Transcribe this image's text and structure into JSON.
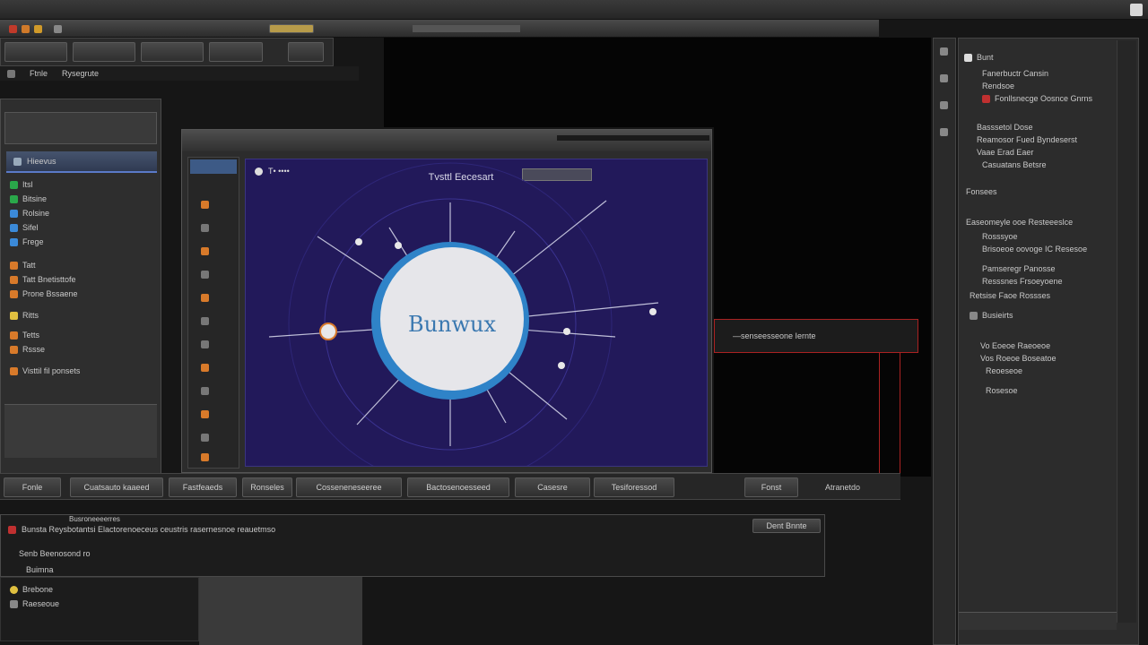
{
  "app": {
    "top_right_label": "▪"
  },
  "toolbar": {
    "menu_items": [
      "Ftnle",
      "Rysegrute"
    ]
  },
  "left_panel": {
    "header": "Hieevus",
    "items": [
      {
        "label": "Itsl",
        "color": "#2aa84a"
      },
      {
        "label": "Bitsine",
        "color": "#2aa84a"
      },
      {
        "label": "Rolsine",
        "color": "#3b8ad8"
      },
      {
        "label": "Sifel",
        "color": "#3b8ad8"
      },
      {
        "label": "Frege",
        "color": "#3b8ad8"
      },
      {
        "label": "Tatt",
        "color": "#d87a2a"
      },
      {
        "label": "Tatt Bnetisttofe",
        "color": "#d87a2a"
      },
      {
        "label": "Prone Bssaene",
        "color": "#d87a2a"
      },
      {
        "label": "Ritts",
        "color": "#e0c040"
      },
      {
        "label": "Tetts",
        "color": "#d87a2a"
      },
      {
        "label": "Rssse",
        "color": "#d87a2a"
      },
      {
        "label": "Visttil fil ponsets",
        "color": "#d87a2a"
      }
    ]
  },
  "canvas": {
    "header_label": "T• ••••",
    "title": "Tvsttl Eecesart",
    "node_label": "Bunwux",
    "accent": "#2f83c8",
    "background": "#22195a"
  },
  "tool_strip": {
    "icons": [
      "orange",
      "gray",
      "orange",
      "gray",
      "orange",
      "gray",
      "gray",
      "orange",
      "gray",
      "orange",
      "gray",
      "orange"
    ]
  },
  "bottom_tabs": [
    {
      "label": "Fonle"
    },
    {
      "label": "Cuatsauto kaaeed"
    },
    {
      "label": "Fastfeaeds"
    },
    {
      "label": "Ronseles"
    },
    {
      "label": "Cosseneneseeree"
    },
    {
      "label": "Bactosenoesseed"
    },
    {
      "label": "Casesre"
    },
    {
      "label": "Tesiforessod"
    },
    {
      "label": "Fonst"
    }
  ],
  "bottom_right_label": "Atranetdo",
  "callout": {
    "text": "—senseesseone Iernte"
  },
  "status_bar": {
    "text": "Bunsta  Reysbotantsi Elactorenoeceus ceustris rasernesnoe reauetmso",
    "sub_label": "Busroneeeerres",
    "button": "Dent Bnnte",
    "line2": "Senb Beenosond ro",
    "line3": "Buimna",
    "items": [
      "Brebone",
      "Raeseoue"
    ]
  },
  "right_panel": {
    "lines": [
      {
        "text": "Bunt"
      },
      {
        "text": "Fanerbuctr Cansin"
      },
      {
        "text": "Rendsoe"
      },
      {
        "text": "Fonllsnecge Oosnce Gnrns"
      },
      {
        "text": "Basssetol Dose"
      },
      {
        "text": "Reamosor Fued Byndeserst"
      },
      {
        "text": "Vaae Erad Eaer"
      },
      {
        "text": "Casuatans Betsre"
      },
      {
        "text": "Fonsees"
      },
      {
        "text": "Easeomeyle ooe Resteeeslce"
      },
      {
        "text": "Rosssyoe"
      },
      {
        "text": "Brisoeoe oovoge IC Resesoe"
      },
      {
        "text": "Pamseregr Panosse"
      },
      {
        "text": "Resssnes Frsoeyoene"
      },
      {
        "text": "Retsise Faoe Rossses"
      },
      {
        "text": "Busieirts"
      },
      {
        "text": "Vo Eoeoe Raeoeoe"
      },
      {
        "text": "Vos Roeoe Boseatoe"
      },
      {
        "text": "Reoeseoe"
      },
      {
        "text": "Rosesoe"
      }
    ]
  }
}
